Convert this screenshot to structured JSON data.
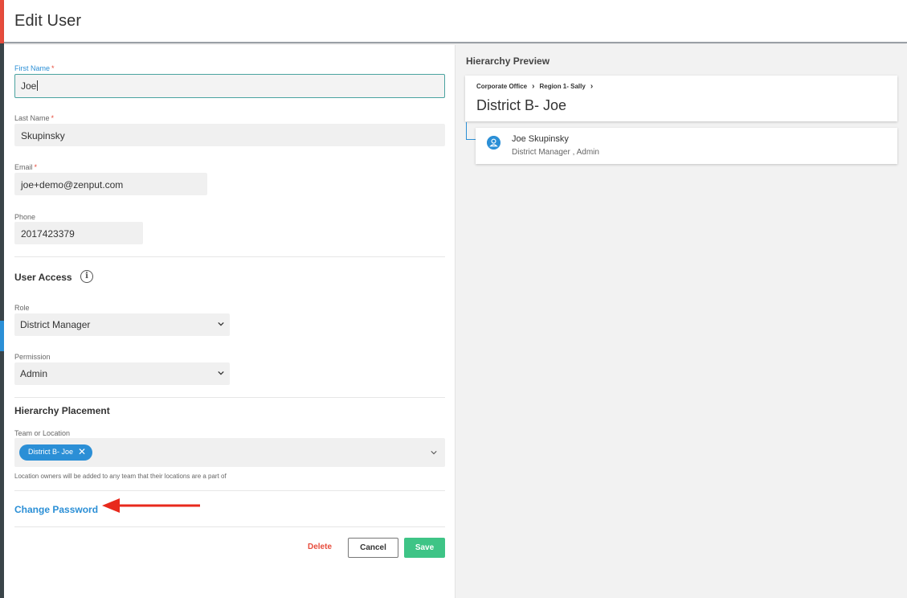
{
  "header": {
    "title": "Edit User"
  },
  "form": {
    "first_name": {
      "label": "First Name",
      "required_mark": "*",
      "value": "Joe"
    },
    "last_name": {
      "label": "Last Name",
      "required_mark": "*",
      "value": "Skupinsky"
    },
    "email": {
      "label": "Email",
      "required_mark": "*",
      "value": "joe+demo@zenput.com"
    },
    "phone": {
      "label": "Phone",
      "value": "2017423379"
    },
    "user_access": {
      "title": "User Access",
      "info_icon": "i",
      "role": {
        "label": "Role",
        "selected": "District Manager"
      },
      "permission": {
        "label": "Permission",
        "selected": "Admin"
      }
    },
    "hierarchy": {
      "title": "Hierarchy Placement",
      "team_label": "Team or Location",
      "selected_chip": "District B- Joe",
      "chip_remove": "✕",
      "hint": "Location owners will be added to any team that their locations are a part of"
    },
    "change_password": "Change Password",
    "buttons": {
      "delete": "Delete",
      "cancel": "Cancel",
      "save": "Save"
    }
  },
  "preview": {
    "title": "Hierarchy Preview",
    "breadcrumb": [
      "Corporate Office",
      "Region 1- Sally"
    ],
    "breadcrumb_sep": "›",
    "current_node": "District B- Joe",
    "user": {
      "name": "Joe Skupinsky",
      "roles": "District Manager , Admin"
    }
  },
  "colors": {
    "accent_blue": "#2b8fd6",
    "save_green": "#3ec486",
    "danger_red": "#e74c3c",
    "annotation_arrow": "#e8291c"
  }
}
